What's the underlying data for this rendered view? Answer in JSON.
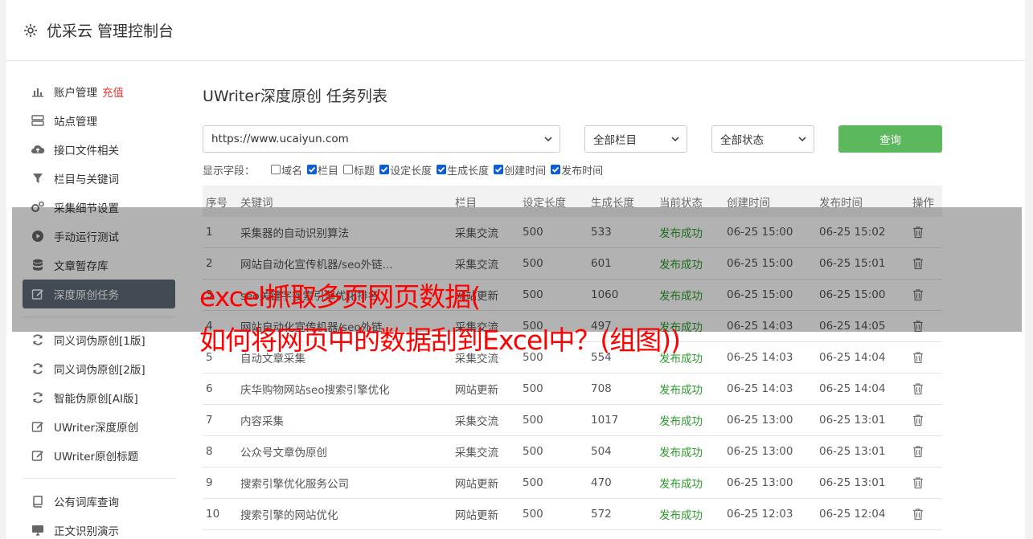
{
  "header": {
    "title": "优采云 管理控制台"
  },
  "sidebar": {
    "items": [
      {
        "label": "账户管理",
        "extra": "充值",
        "icon": "bar-chart-icon"
      },
      {
        "label": "站点管理",
        "icon": "server-icon"
      },
      {
        "label": "接口文件相关",
        "icon": "cloud-upload-icon"
      },
      {
        "label": "栏目与关键词",
        "icon": "filter-icon"
      },
      {
        "label": "采集细节设置",
        "icon": "gears-icon"
      },
      {
        "label": "手动运行测试",
        "icon": "play-circle-icon"
      },
      {
        "label": "文章暂存库",
        "icon": "database-icon"
      },
      {
        "label": "深度原创任务",
        "icon": "edit-icon",
        "active": true
      }
    ],
    "items2": [
      {
        "label": "同义词伪原创[1版]",
        "icon": "refresh-icon"
      },
      {
        "label": "同义词伪原创[2版]",
        "icon": "refresh-icon"
      },
      {
        "label": "智能伪原创[AI版]",
        "icon": "refresh-icon"
      },
      {
        "label": "UWriter深度原创",
        "icon": "edit-icon"
      },
      {
        "label": "UWriter原创标题",
        "icon": "edit-icon"
      }
    ],
    "items3": [
      {
        "label": "公有词库查询",
        "icon": "book-icon"
      },
      {
        "label": "正文识别演示",
        "icon": "monitor-icon"
      }
    ]
  },
  "main": {
    "title": "UWriter深度原创 任务列表",
    "site_select": "https://www.ucaiyun.com",
    "column_select": "全部栏目",
    "status_select": "全部状态",
    "query_label": "查询",
    "fields_label": "显示字段：",
    "fields": [
      {
        "label": "域名",
        "checked": false
      },
      {
        "label": "栏目",
        "checked": true
      },
      {
        "label": "标题",
        "checked": false
      },
      {
        "label": "设定长度",
        "checked": true
      },
      {
        "label": "生成长度",
        "checked": true
      },
      {
        "label": "创建时间",
        "checked": true
      },
      {
        "label": "发布时间",
        "checked": true
      }
    ],
    "columns": [
      "序号",
      "关键词",
      "栏目",
      "设定长度",
      "生成长度",
      "当前状态",
      "创建时间",
      "发布时间",
      "操作"
    ],
    "rows": [
      {
        "no": "1",
        "keyword": "采集器的自动识别算法",
        "column": "采集交流",
        "set_len": "500",
        "gen_len": "533",
        "status": "发布成功",
        "created": "06-25 15:00",
        "published": "06-25 15:02"
      },
      {
        "no": "2",
        "keyword": "网站自动化宣传机器/seo外链...",
        "column": "采集交流",
        "set_len": "500",
        "gen_len": "601",
        "status": "发布成功",
        "created": "06-25 15:00",
        "published": "06-25 15:01"
      },
      {
        "no": "3",
        "keyword": "seo关键字搜索引擎优化排名",
        "column": "网站更新",
        "set_len": "500",
        "gen_len": "1060",
        "status": "发布成功",
        "created": "06-25 15:00",
        "published": "06-25 15:00"
      },
      {
        "no": "4",
        "keyword": "网站自动化宣传机器/seo外链",
        "column": "采集交流",
        "set_len": "500",
        "gen_len": "497",
        "status": "发布成功",
        "created": "06-25 14:03",
        "published": "06-25 14:05"
      },
      {
        "no": "5",
        "keyword": "自动文章采集",
        "column": "采集交流",
        "set_len": "500",
        "gen_len": "554",
        "status": "发布成功",
        "created": "06-25 14:03",
        "published": "06-25 14:04"
      },
      {
        "no": "6",
        "keyword": "庆华购物网站seo搜索引擎优化",
        "column": "网站更新",
        "set_len": "500",
        "gen_len": "708",
        "status": "发布成功",
        "created": "06-25 14:03",
        "published": "06-25 14:04"
      },
      {
        "no": "7",
        "keyword": "内容采集",
        "column": "采集交流",
        "set_len": "500",
        "gen_len": "1017",
        "status": "发布成功",
        "created": "06-25 13:00",
        "published": "06-25 13:01"
      },
      {
        "no": "8",
        "keyword": "公众号文章伪原创",
        "column": "采集交流",
        "set_len": "500",
        "gen_len": "504",
        "status": "发布成功",
        "created": "06-25 13:00",
        "published": "06-25 13:01"
      },
      {
        "no": "9",
        "keyword": "搜索引擎优化服务公司",
        "column": "网站更新",
        "set_len": "500",
        "gen_len": "470",
        "status": "发布成功",
        "created": "06-25 13:00",
        "published": "06-25 13:01"
      },
      {
        "no": "10",
        "keyword": "搜索引擎的网站优化",
        "column": "网站更新",
        "set_len": "500",
        "gen_len": "572",
        "status": "发布成功",
        "created": "06-25 12:03",
        "published": "06-25 12:04"
      }
    ]
  },
  "overlay": {
    "line1": "excel抓取多页网页数据(",
    "line2": "如何将网页中的数据刮到Excel中？(组图))"
  },
  "colors": {
    "accent_green": "#5cb85c",
    "active_bg": "#5f6b78",
    "status_green": "#2e9b2e",
    "caption_red": "#ff0000"
  }
}
